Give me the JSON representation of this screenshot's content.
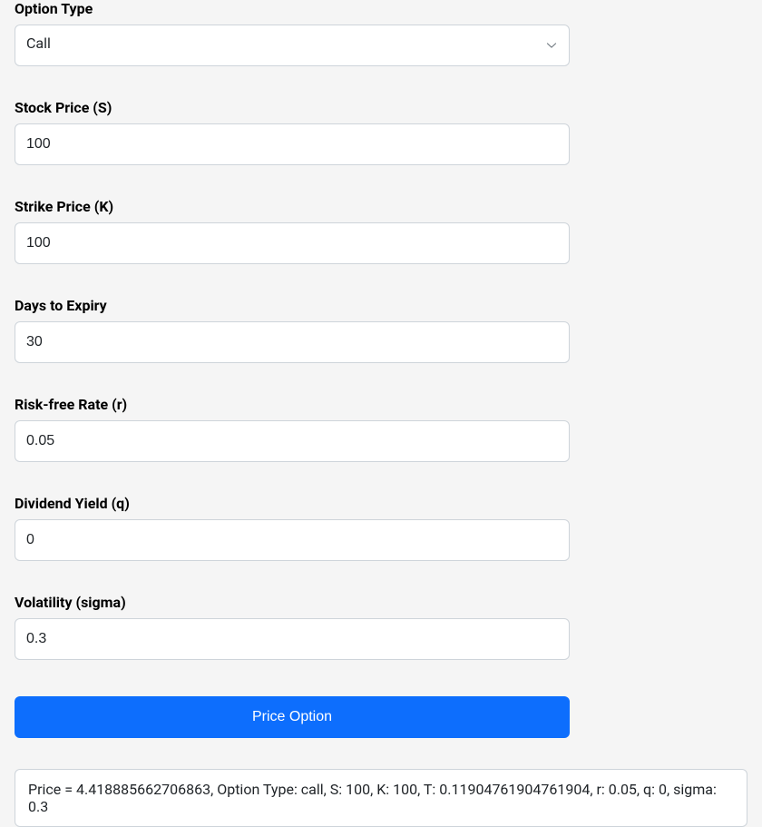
{
  "form": {
    "option_type": {
      "label": "Option Type",
      "value": "Call"
    },
    "stock_price": {
      "label": "Stock Price (S)",
      "value": "100"
    },
    "strike_price": {
      "label": "Strike Price (K)",
      "value": "100"
    },
    "days_to_expiry": {
      "label": "Days to Expiry",
      "value": "30"
    },
    "risk_free_rate": {
      "label": "Risk-free Rate (r)",
      "value": "0.05"
    },
    "dividend_yield": {
      "label": "Dividend Yield (q)",
      "value": "0"
    },
    "volatility": {
      "label": "Volatility (sigma)",
      "value": "0.3"
    },
    "submit_label": "Price Option"
  },
  "result": {
    "text": "Price = 4.418885662706863, Option Type: call, S: 100, K: 100, T: 0.11904761904761904, r: 0.05, q: 0, sigma: 0.3"
  }
}
